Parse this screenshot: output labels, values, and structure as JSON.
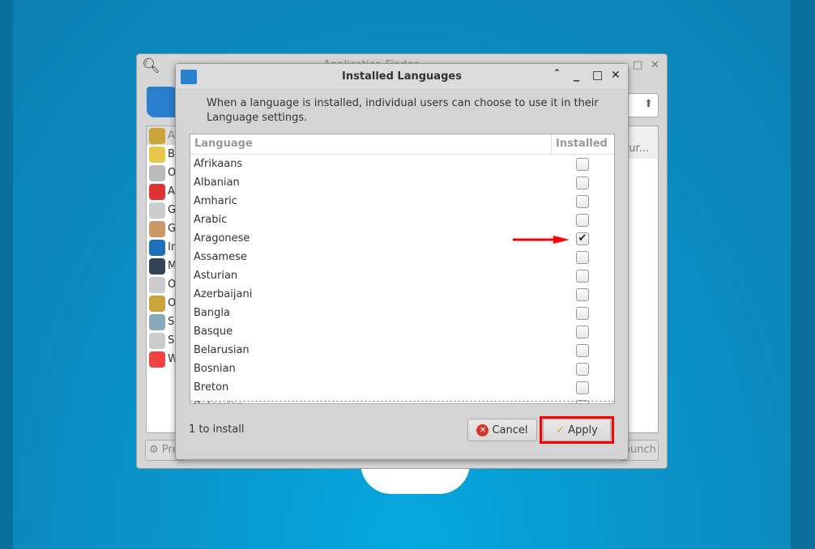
{
  "background_window": {
    "title": "Application Finder",
    "sidebar_items": [
      "A",
      "B",
      "O",
      "A",
      "G",
      "G",
      "In",
      "M",
      "O",
      "O",
      "S",
      "S",
      "W"
    ],
    "column_fragment": "pur...",
    "preferences_fragment": "Pre",
    "launch_fragment": "aunch"
  },
  "dialog": {
    "title": "Installed Languages",
    "description": "When a language is installed, individual users can choose to use it in their Language settings.",
    "columns": [
      "Language",
      "Installed"
    ],
    "languages": [
      {
        "name": "Afrikaans",
        "installed": false
      },
      {
        "name": "Albanian",
        "installed": false
      },
      {
        "name": "Amharic",
        "installed": false
      },
      {
        "name": "Arabic",
        "installed": false
      },
      {
        "name": "Aragonese",
        "installed": true
      },
      {
        "name": "Assamese",
        "installed": false
      },
      {
        "name": "Asturian",
        "installed": false
      },
      {
        "name": "Azerbaijani",
        "installed": false
      },
      {
        "name": "Bangla",
        "installed": false
      },
      {
        "name": "Basque",
        "installed": false
      },
      {
        "name": "Belarusian",
        "installed": false
      },
      {
        "name": "Bosnian",
        "installed": false
      },
      {
        "name": "Breton",
        "installed": false
      },
      {
        "name": "Bulgarian",
        "installed": false
      }
    ],
    "status": "1 to install",
    "cancel_label": "Cancel",
    "apply_label": "Apply"
  },
  "colors": {
    "annotation": "#ff0000",
    "desktop": "#0a8fc4"
  }
}
